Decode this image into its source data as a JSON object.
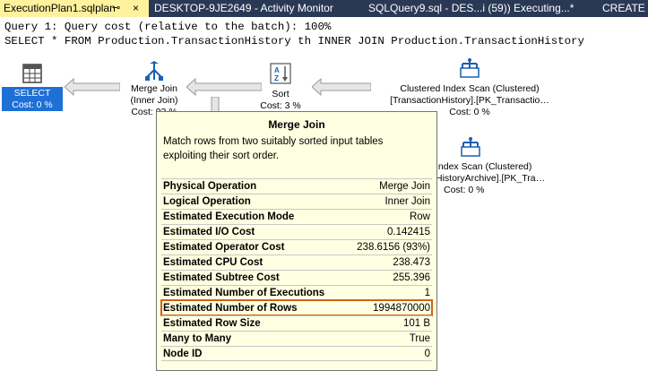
{
  "tabs": [
    {
      "label": "ExecutionPlan1.sqlplan",
      "pin": "⊸",
      "close": "×"
    },
    {
      "label": "DESKTOP-9JE2649 - Activity Monitor"
    },
    {
      "label": "SQLQuery9.sql - DES...i (59)) Executing...*"
    },
    {
      "label": "CREATE N"
    }
  ],
  "query": {
    "cost_line": "Query 1: Query cost (relative to the batch): 100%",
    "sql_line": "SELECT * FROM Production.TransactionHistory th INNER JOIN Production.TransactionHistory"
  },
  "plan": {
    "select_node": {
      "name": "SELECT",
      "cost": "Cost: 0 %"
    },
    "merge_node": {
      "line1": "Merge Join",
      "line2": "(Inner Join)",
      "cost": "Cost: 93 %"
    },
    "sort_node": {
      "line1": "Sort",
      "cost": "Cost: 3 %"
    },
    "scan1_node": {
      "line1": "Clustered Index Scan (Clustered)",
      "line2": "[TransactionHistory].[PK_Transactio…",
      "cost": "Cost: 0 %"
    },
    "scan2_node": {
      "line1": "Index Scan (Clustered)",
      "line2": "HistoryArchive].[PK_Tra…",
      "cost": "Cost: 0 %"
    }
  },
  "tooltip": {
    "title": "Merge Join",
    "description": "Match rows from two suitably sorted input tables exploiting their sort order.",
    "rows": [
      {
        "key": "Physical Operation",
        "value": "Merge Join"
      },
      {
        "key": "Logical Operation",
        "value": "Inner Join"
      },
      {
        "key": "Estimated Execution Mode",
        "value": "Row"
      },
      {
        "key": "Estimated I/O Cost",
        "value": "0.142415"
      },
      {
        "key": "Estimated Operator Cost",
        "value": "238.6156 (93%)"
      },
      {
        "key": "Estimated CPU Cost",
        "value": "238.473"
      },
      {
        "key": "Estimated Subtree Cost",
        "value": "255.396"
      },
      {
        "key": "Estimated Number of Executions",
        "value": "1"
      },
      {
        "key": "Estimated Number of Rows",
        "value": "1994870000"
      },
      {
        "key": "Estimated Row Size",
        "value": "101 B"
      },
      {
        "key": "Many to Many",
        "value": "True"
      },
      {
        "key": "Node ID",
        "value": "0"
      }
    ],
    "highlight_color": "#d2601a"
  },
  "colors": {
    "tabstrip": "#293955",
    "active_tab": "#fff29d",
    "select_highlight": "#1e6fd6",
    "tooltip_bg": "#ffffe1"
  }
}
